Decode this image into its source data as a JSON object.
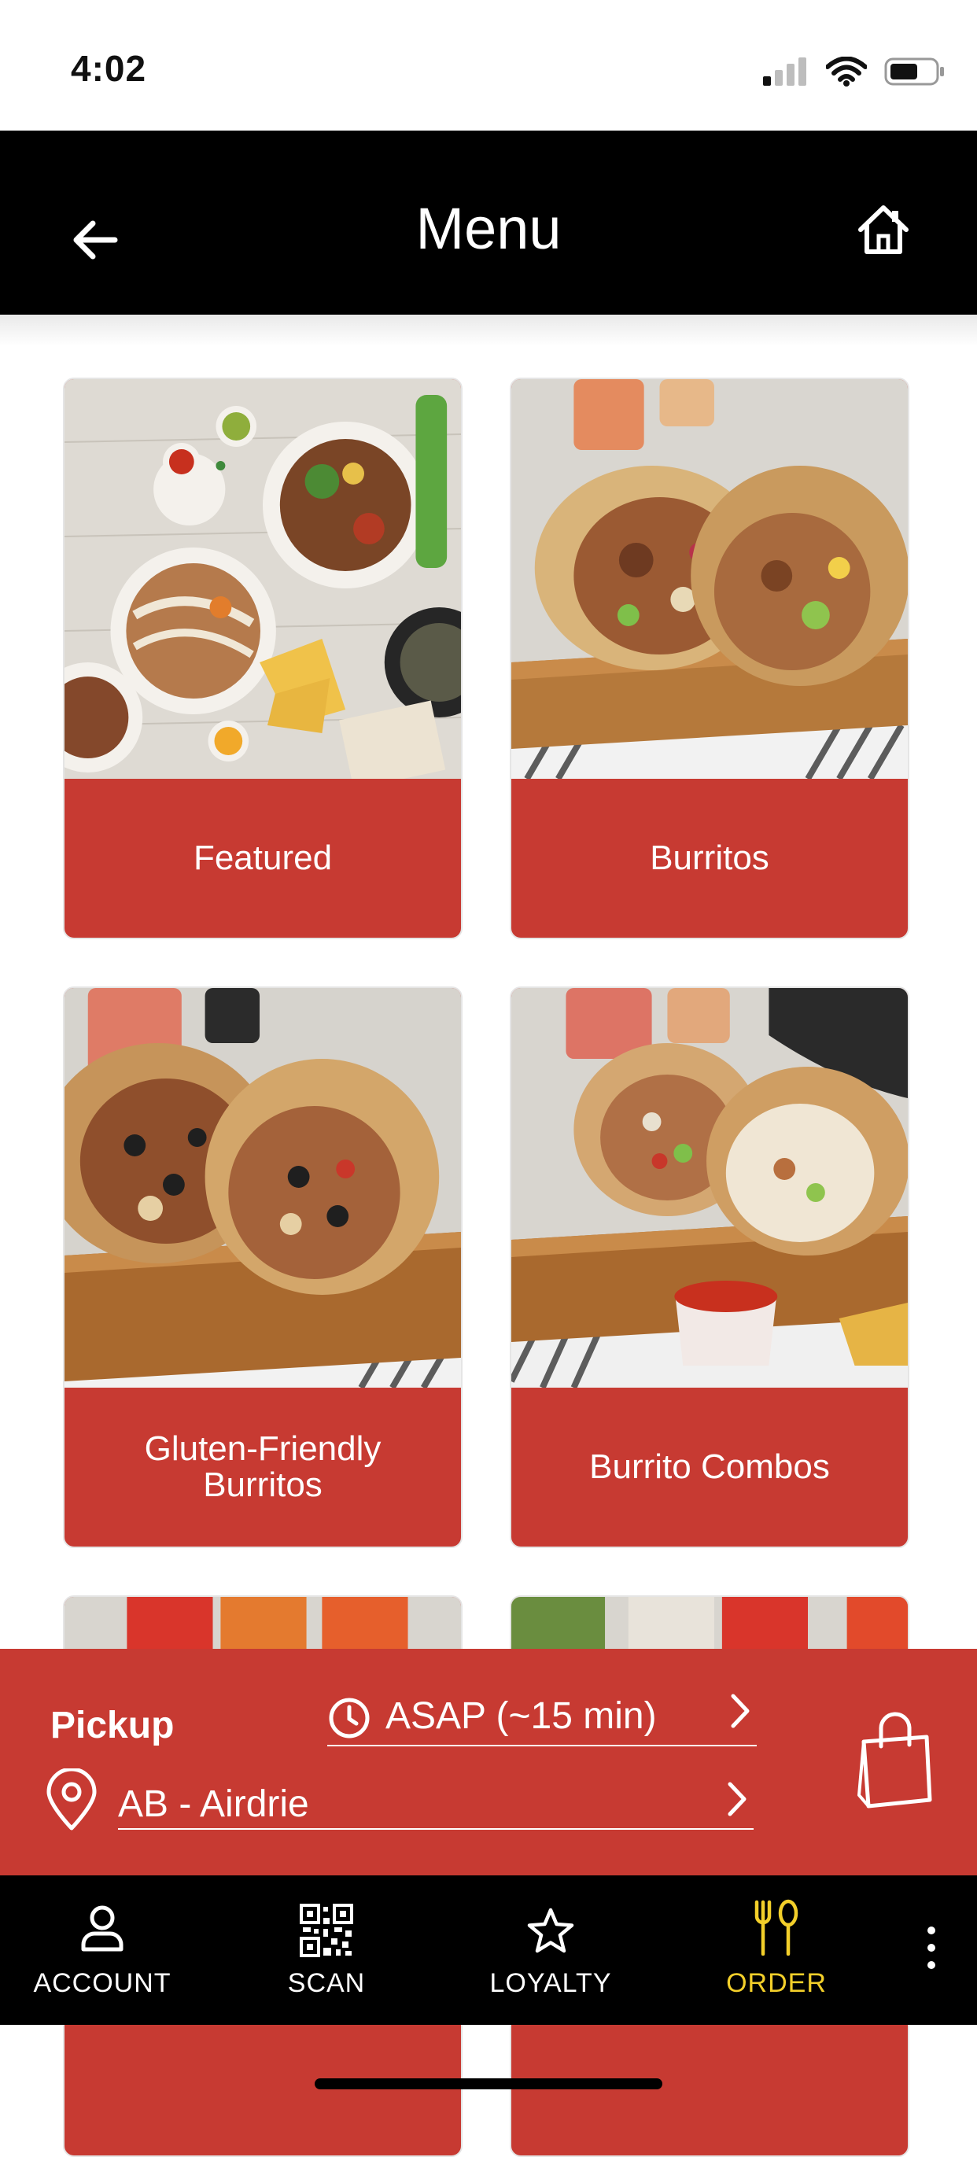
{
  "status_bar": {
    "time": "4:02"
  },
  "header": {
    "title": "Menu",
    "back_icon": "arrow-left-icon",
    "home_icon": "home-icon"
  },
  "categories": [
    {
      "label": "Featured"
    },
    {
      "label": "Burritos"
    },
    {
      "label": "Gluten-Friendly Burritos"
    },
    {
      "label": "Burrito Combos"
    },
    {
      "label": ""
    },
    {
      "label": ""
    }
  ],
  "pickup": {
    "mode_label": "Pickup",
    "time_value": "ASAP (~15 min)",
    "location_value": "AB - Airdrie"
  },
  "tabs": [
    {
      "label": "ACCOUNT",
      "icon": "person-icon"
    },
    {
      "label": "SCAN",
      "icon": "qr-code-icon"
    },
    {
      "label": "LOYALTY",
      "icon": "star-icon"
    },
    {
      "label": "ORDER",
      "icon": "fork-spoon-icon"
    }
  ],
  "colors": {
    "brand_red": "#c73a32",
    "active_tab": "#f3cf2a",
    "header_bg": "#000000"
  }
}
